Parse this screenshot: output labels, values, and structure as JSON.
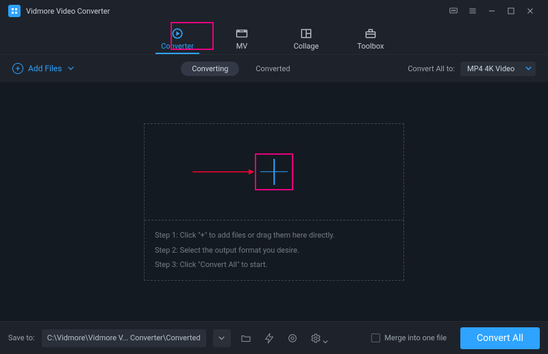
{
  "app": {
    "title": "Vidmore Video Converter"
  },
  "tabs": {
    "converter": "Converter",
    "mv": "MV",
    "collage": "Collage",
    "toolbox": "Toolbox"
  },
  "toolbar": {
    "add_files": "Add Files",
    "converting": "Converting",
    "converted": "Converted",
    "convert_all_to": "Convert All to:",
    "format": "MP4 4K Video"
  },
  "dropzone": {
    "step1": "Step 1: Click \"+\" to add files or drag them here directly.",
    "step2": "Step 2: Select the output format you desire.",
    "step3": "Step 3: Click \"Convert All\" to start."
  },
  "footer": {
    "save_to": "Save to:",
    "path": "C:\\Vidmore\\Vidmore V... Converter\\Converted",
    "merge": "Merge into one file",
    "convert_all": "Convert All"
  }
}
